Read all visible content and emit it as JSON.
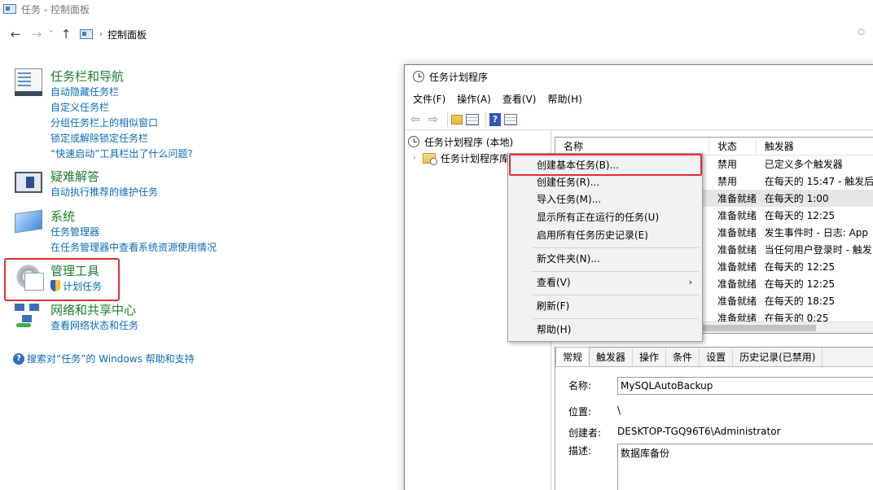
{
  "control_panel": {
    "window_title": "任务 - 控制面板",
    "nav": {
      "back": "←",
      "forward": "→",
      "recent": "˅",
      "up": "↑",
      "breadcrumb_sep": "›",
      "address": "控制面板",
      "search_marker": "○"
    },
    "categories": [
      {
        "title": "任务栏和导航",
        "icon": "taskbar-icon",
        "links": [
          "自动隐藏任务栏",
          "自定义任务栏",
          "分组任务栏上的相似窗口",
          "锁定或解除锁定任务栏",
          "“快速启动”工具栏出了什么问题?"
        ]
      },
      {
        "title": "疑难解答",
        "icon": "troubleshoot-icon",
        "links": [
          "自动执行推荐的维护任务"
        ]
      },
      {
        "title": "系统",
        "icon": "system-icon",
        "links": [
          "任务管理器",
          "在任务管理器中查看系统资源使用情况"
        ]
      },
      {
        "title": "管理工具",
        "icon": "admin-tools-icon",
        "links": [
          "计划任务"
        ]
      },
      {
        "title": "网络和共享中心",
        "icon": "network-icon",
        "links": [
          "查看网络状态和任务"
        ]
      }
    ],
    "help_icon": "?",
    "help_link": "搜索对“任务”的 Windows 帮助和支持",
    "highlight_color": "#e03030"
  },
  "task_scheduler": {
    "title": "任务计划程序",
    "menu": [
      "文件(F)",
      "操作(A)",
      "查看(V)",
      "帮助(H)"
    ],
    "toolbar": {
      "back": "⇦",
      "forward": "⇨",
      "help": "?"
    },
    "tree": {
      "root": "任务计划程序 (本地)",
      "expander": "›",
      "child": "任务计划程序库"
    },
    "list": {
      "headers": [
        "名称",
        "状态",
        "触发器"
      ],
      "rows": [
        {
          "name": "",
          "status": "禁用",
          "trigger": "已定义多个触发器"
        },
        {
          "name": "",
          "status": "禁用",
          "trigger": "在每天的 15:47 - 触发后"
        },
        {
          "name": "",
          "status": "准备就绪",
          "trigger": "在每天的 1:00"
        },
        {
          "name": "",
          "status": "准备就绪",
          "trigger": "在每天的 12:25"
        },
        {
          "name": "",
          "status": "准备就绪",
          "trigger": "发生事件时 - 日志: App"
        },
        {
          "name": "",
          "status": "准备就绪",
          "trigger": "当任何用户登录时 - 触发"
        },
        {
          "name": "",
          "status": "准备就绪",
          "trigger": "在每天的 12:25"
        },
        {
          "name": "",
          "status": "准备就绪",
          "trigger": "在每天的 12:25"
        },
        {
          "name": "",
          "status": "准备就绪",
          "trigger": "在每天的 18:25"
        },
        {
          "name": "",
          "status": "准备就绪",
          "trigger": "在每天的 0:25"
        }
      ]
    },
    "detail": {
      "tabs": [
        "常规",
        "触发器",
        "操作",
        "条件",
        "设置",
        "历史记录(已禁用)"
      ],
      "name_label": "名称:",
      "name_value": "MySQLAutoBackup",
      "location_label": "位置:",
      "location_value": "\\",
      "author_label": "创建者:",
      "author_value": "DESKTOP-TGQ96T6\\Administrator",
      "desc_label": "描述:",
      "desc_value": "数据库备份"
    }
  },
  "context_menu": {
    "items": [
      {
        "label": "创建基本任务(B)..."
      },
      {
        "label": "创建任务(R)..."
      },
      {
        "label": "导入任务(M)..."
      },
      {
        "label": "显示所有正在运行的任务(U)"
      },
      {
        "label": "启用所有任务历史记录(E)"
      },
      {
        "label": "新文件夹(N)..."
      },
      {
        "label": "查看(V)",
        "submenu_arrow": "›"
      },
      {
        "label": "刷新(F)"
      },
      {
        "label": "帮助(H)"
      }
    ]
  }
}
